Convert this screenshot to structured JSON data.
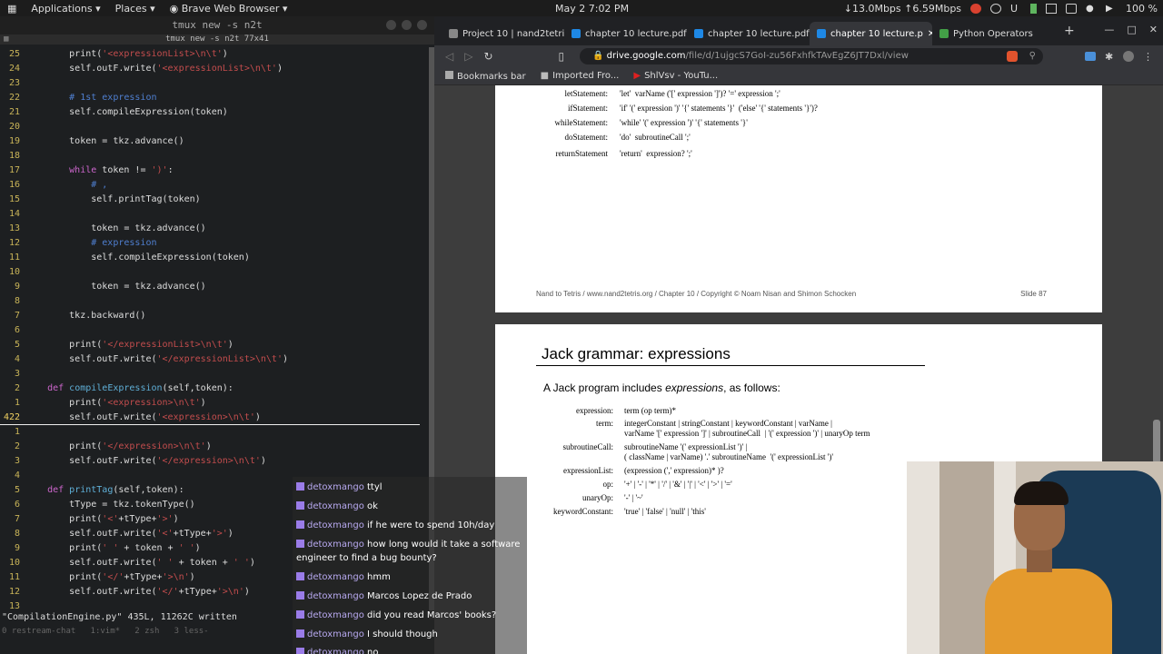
{
  "topbar": {
    "applications": "Applications ▾",
    "places": "Places ▾",
    "browser_menu": "Brave Web Browser ▾",
    "clock": "May 2   7:02 PM",
    "net_speed": "↓13.0Mbps ↑6.59Mbps",
    "battery": "100 %"
  },
  "terminal": {
    "title": "tmux new -s n2t",
    "subtitle": "tmux new -s n2t 77x41",
    "lines": [
      {
        "n": "25",
        "segs": [
          [
            "tx",
            "        print("
          ],
          [
            "str",
            "'<expressionList>\\n\\t'"
          ],
          [
            "tx",
            ")"
          ]
        ]
      },
      {
        "n": "24",
        "segs": [
          [
            "tx",
            "        self.outF.write("
          ],
          [
            "str",
            "'<expressionList>\\n\\t'"
          ],
          [
            "tx",
            ")"
          ]
        ]
      },
      {
        "n": "23",
        "segs": [
          [
            "tx",
            ""
          ]
        ]
      },
      {
        "n": "22",
        "segs": [
          [
            "cm",
            "        # 1st expression"
          ]
        ]
      },
      {
        "n": "21",
        "segs": [
          [
            "tx",
            "        self.compileExpression(token)"
          ]
        ]
      },
      {
        "n": "20",
        "segs": [
          [
            "tx",
            ""
          ]
        ]
      },
      {
        "n": "19",
        "segs": [
          [
            "tx",
            "        token = tkz.advance()"
          ]
        ]
      },
      {
        "n": "18",
        "segs": [
          [
            "tx",
            ""
          ]
        ]
      },
      {
        "n": "17",
        "segs": [
          [
            "kw",
            "        while"
          ],
          [
            "tx",
            " token != "
          ],
          [
            "str",
            "')'"
          ],
          [
            "tx",
            ":"
          ]
        ]
      },
      {
        "n": "16",
        "segs": [
          [
            "cm",
            "            # ,"
          ]
        ]
      },
      {
        "n": "15",
        "segs": [
          [
            "tx",
            "            self.printTag(token)"
          ]
        ]
      },
      {
        "n": "14",
        "segs": [
          [
            "tx",
            ""
          ]
        ]
      },
      {
        "n": "13",
        "segs": [
          [
            "tx",
            "            token = tkz.advance()"
          ]
        ]
      },
      {
        "n": "12",
        "segs": [
          [
            "cm",
            "            # expression"
          ]
        ]
      },
      {
        "n": "11",
        "segs": [
          [
            "tx",
            "            self.compileExpression(token)"
          ]
        ]
      },
      {
        "n": "10",
        "segs": [
          [
            "tx",
            ""
          ]
        ]
      },
      {
        "n": "9",
        "segs": [
          [
            "tx",
            "            token = tkz.advance()"
          ]
        ]
      },
      {
        "n": "8",
        "segs": [
          [
            "tx",
            ""
          ]
        ]
      },
      {
        "n": "7",
        "segs": [
          [
            "tx",
            "        tkz.backward()"
          ]
        ]
      },
      {
        "n": "6",
        "segs": [
          [
            "tx",
            ""
          ]
        ]
      },
      {
        "n": "5",
        "segs": [
          [
            "tx",
            "        print("
          ],
          [
            "str",
            "'</expressionList>\\n\\t'"
          ],
          [
            "tx",
            ")"
          ]
        ]
      },
      {
        "n": "4",
        "segs": [
          [
            "tx",
            "        self.outF.write("
          ],
          [
            "str",
            "'</expressionList>\\n\\t'"
          ],
          [
            "tx",
            ")"
          ]
        ]
      },
      {
        "n": "3",
        "segs": [
          [
            "tx",
            ""
          ]
        ]
      },
      {
        "n": "2",
        "segs": [
          [
            "kw",
            "    def"
          ],
          [
            "fn",
            " compileExpression"
          ],
          [
            "tx",
            "(self,token):"
          ]
        ]
      },
      {
        "n": "1",
        "segs": [
          [
            "tx",
            "        print("
          ],
          [
            "str",
            "'<expression>\\n\\t'"
          ],
          [
            "tx",
            ")"
          ]
        ]
      },
      {
        "n": "422",
        "cur": true,
        "segs": [
          [
            "tx",
            "        self.outF.write("
          ],
          [
            "str",
            "'<expression>\\n\\t'"
          ],
          [
            "tx",
            ")"
          ]
        ]
      },
      {
        "n": "1",
        "segs": [
          [
            "tx",
            ""
          ]
        ]
      },
      {
        "n": "2",
        "segs": [
          [
            "tx",
            "        print("
          ],
          [
            "str",
            "'</expression>\\n\\t'"
          ],
          [
            "tx",
            ")"
          ]
        ]
      },
      {
        "n": "3",
        "segs": [
          [
            "tx",
            "        self.outF.write("
          ],
          [
            "str",
            "'</expression>\\n\\t'"
          ],
          [
            "tx",
            ")"
          ]
        ]
      },
      {
        "n": "4",
        "segs": [
          [
            "tx",
            ""
          ]
        ]
      },
      {
        "n": "5",
        "segs": [
          [
            "kw",
            "    def"
          ],
          [
            "fn",
            " printTag"
          ],
          [
            "tx",
            "(self,token):"
          ]
        ]
      },
      {
        "n": "6",
        "segs": [
          [
            "tx",
            "        tType = tkz.tokenType()"
          ]
        ]
      },
      {
        "n": "7",
        "segs": [
          [
            "tx",
            "        print("
          ],
          [
            "str",
            "'<'"
          ],
          [
            "tx",
            "+tType+"
          ],
          [
            "str",
            "'>'"
          ],
          [
            "tx",
            ")"
          ]
        ]
      },
      {
        "n": "8",
        "segs": [
          [
            "tx",
            "        self.outF.write("
          ],
          [
            "str",
            "'<'"
          ],
          [
            "tx",
            "+tType+"
          ],
          [
            "str",
            "'>'"
          ],
          [
            "tx",
            ")"
          ]
        ]
      },
      {
        "n": "9",
        "segs": [
          [
            "tx",
            "        print("
          ],
          [
            "str",
            "' '"
          ],
          [
            "tx",
            " + token + "
          ],
          [
            "str",
            "' '"
          ],
          [
            "tx",
            ")"
          ]
        ]
      },
      {
        "n": "10",
        "segs": [
          [
            "tx",
            "        self.outF.write("
          ],
          [
            "str",
            "' '"
          ],
          [
            "tx",
            " + token + "
          ],
          [
            "str",
            "' '"
          ],
          [
            "tx",
            ")"
          ]
        ]
      },
      {
        "n": "11",
        "segs": [
          [
            "tx",
            "        print("
          ],
          [
            "str",
            "'</'"
          ],
          [
            "tx",
            "+tType+"
          ],
          [
            "str",
            "'>\\n'"
          ],
          [
            "tx",
            ")"
          ]
        ]
      },
      {
        "n": "12",
        "segs": [
          [
            "tx",
            "        self.outF.write("
          ],
          [
            "str",
            "'</'"
          ],
          [
            "tx",
            "+tType+"
          ],
          [
            "str",
            "'>\\n'"
          ],
          [
            "tx",
            ")"
          ]
        ]
      },
      {
        "n": "13",
        "segs": [
          [
            "tx",
            ""
          ]
        ]
      }
    ],
    "vim_status": "\"CompilationEngine.py\" 435L, 11262C written",
    "tmux_status": "0 restream-chat   1:vim*   2 zsh   3 less-"
  },
  "chat": [
    {
      "user": "detoxmango",
      "text": " ttyl"
    },
    {
      "user": "detoxmango",
      "text": " ok"
    },
    {
      "user": "detoxmango",
      "text": " if he were to spend 10h/day"
    },
    {
      "user": "detoxmango",
      "text": " how long would it take a software engineer to find a bug bounty?"
    },
    {
      "user": "detoxmango",
      "text": " hmm"
    },
    {
      "user": "detoxmango",
      "text": " Marcos Lopez de Prado"
    },
    {
      "user": "detoxmango",
      "text": " did you read Marcos' books?"
    },
    {
      "user": "detoxmango",
      "text": " I should though"
    },
    {
      "user": "detoxmango",
      "text": " no"
    }
  ],
  "browser": {
    "tabs": [
      {
        "label": "Project 10 | nand2tetris",
        "color": "#888888"
      },
      {
        "label": "chapter 10 lecture.pdf",
        "color": "#1e88e5"
      },
      {
        "label": "chapter 10 lecture.pdf",
        "color": "#1e88e5"
      },
      {
        "label": "chapter 10 lecture.p",
        "color": "#1e88e5",
        "active": true
      },
      {
        "label": "Python Operators",
        "color": "#43a047"
      }
    ],
    "new_tab": "+",
    "url_prefix": "drive.google.com",
    "url_rest": "/file/d/1ujgcS7GoI-zu56FxhfkTAvEgZ6JT7Dxl/view",
    "bookmarks": [
      "Bookmarks bar",
      "Imported Fro...",
      "ShlVsv - YouTu..."
    ]
  },
  "slide1": {
    "rows": [
      {
        "lbl": "letStatement:",
        "def": "'let'  varName ('[' expression ']')? '=' expression ';'"
      },
      {
        "lbl": "ifStatement:",
        "def": "'if' '(' expression ')' '{' statements '}'  ('else' '{' statements '}')?"
      },
      {
        "lbl": "whileStatement:",
        "def": "'while' '(' expression ')' '{' statements '}'"
      },
      {
        "lbl": "doStatement:",
        "def": "'do'  subroutineCall ';'"
      },
      {
        "lbl": "returnStatement",
        "def": "'return'  expression? ';'"
      }
    ],
    "footer_left": "Nand to Tetris / www.nand2tetris.org / Chapter 10 / Copyright © Noam Nisan and Shimon Schocken",
    "footer_right": "Slide 87"
  },
  "slide2": {
    "title": "Jack grammar: expressions",
    "intro_pre": "A Jack program includes ",
    "intro_em": "expressions",
    "intro_post": ", as follows:",
    "rows": [
      {
        "lbl": "expression:",
        "def": "term (op term)*"
      },
      {
        "lbl": "term:",
        "def": "integerConstant | stringConstant | keywordConstant | varName |"
      },
      {
        "lbl": "",
        "def": "varName '[' expression ']' | subroutineCall  | '(' expression ')' | unaryOp term"
      },
      {
        "lbl": "subroutineCall:",
        "def": "subroutineName '(' expressionList ')' |"
      },
      {
        "lbl": "",
        "def": "( className | varName) '.' subroutineName  '(' expressionList ')'"
      },
      {
        "lbl": "expressionList:",
        "def": "(expression (',' expression)* )?"
      },
      {
        "lbl": "op:",
        "def": "'+' | '-' | '*' | '/' | '&' | '|' | '<' | '>' | '='"
      },
      {
        "lbl": "unaryOp:",
        "def": "'-' | '~'"
      },
      {
        "lbl": "keywordConstant:",
        "def": "'true' | 'false' | 'null' | 'this'"
      }
    ]
  }
}
